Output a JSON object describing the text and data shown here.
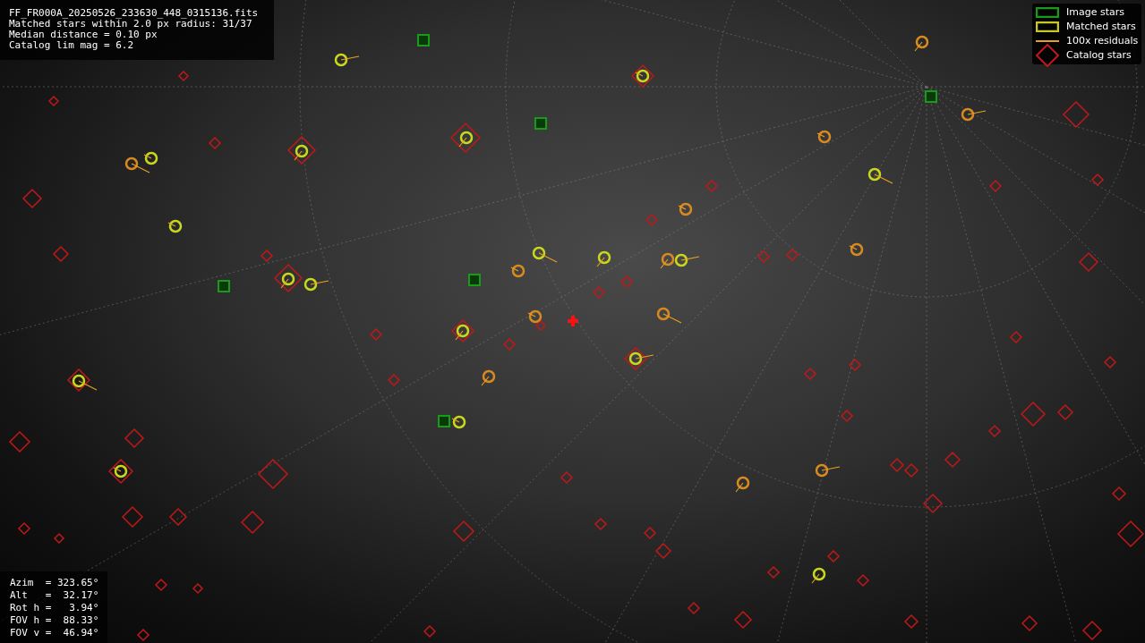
{
  "header": {
    "lines": [
      "FF_FR000A_20250526_233630_448_0315136.fits",
      "Matched stars within 2.0 px radius: 31/37",
      "Median distance = 0.10 px",
      "Catalog lim mag = 6.2"
    ]
  },
  "legend": [
    {
      "kind": "image",
      "label": "Image stars",
      "color": "#1a9a1a"
    },
    {
      "kind": "matched",
      "label": "Matched stars",
      "color": "#c8c81e"
    },
    {
      "kind": "residual",
      "label": "100x residuals",
      "color": "#e8a020"
    },
    {
      "kind": "catalog",
      "label": "Catalog stars",
      "color": "#c01818"
    }
  ],
  "pointing": {
    "lines": [
      "Azim  = 323.65°",
      "Alt   =  32.17°",
      "Rot h =   3.94°",
      "FOV h =  88.33°",
      "FOV v =  46.94°"
    ]
  }
}
